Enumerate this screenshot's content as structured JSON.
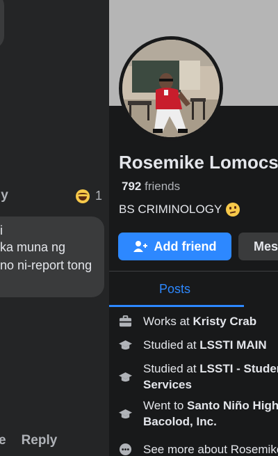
{
  "comments": {
    "reply_top_label": "ly",
    "reaction_count": "1",
    "bubble_lines": [
      "i",
      "ka muna ng",
      "no ni-report tong"
    ],
    "bottom_like_label": "e",
    "bottom_reply_label": "Reply"
  },
  "profile": {
    "name": "Rosemike Lomocso",
    "friends_count": "792",
    "friends_label": " friends",
    "bio": "BS CRIMINOLOGY",
    "add_friend_label": "Add friend",
    "message_label": "Message",
    "tab_posts_label": "Posts",
    "details": [
      {
        "icon": "briefcase-icon",
        "prefix": "Works at ",
        "bold": "Kristy Crab"
      },
      {
        "icon": "graduation-cap-icon",
        "prefix": "Studied at ",
        "bold": "LSSTI MAIN"
      },
      {
        "icon": "graduation-cap-icon",
        "prefix": "Studied at ",
        "bold": "LSSTI - Student",
        "line2": "Services"
      },
      {
        "icon": "graduation-cap-icon",
        "prefix": "Went to ",
        "bold": "Santo Niño High",
        "line2": "Bacolod, Inc."
      },
      {
        "icon": "more-dots-icon",
        "prefix": "See more about Rosemike",
        "bold": ""
      }
    ]
  },
  "colors": {
    "accent": "#2d88ff",
    "background": "#18191a",
    "comment_bubble": "#3a3b3c"
  }
}
